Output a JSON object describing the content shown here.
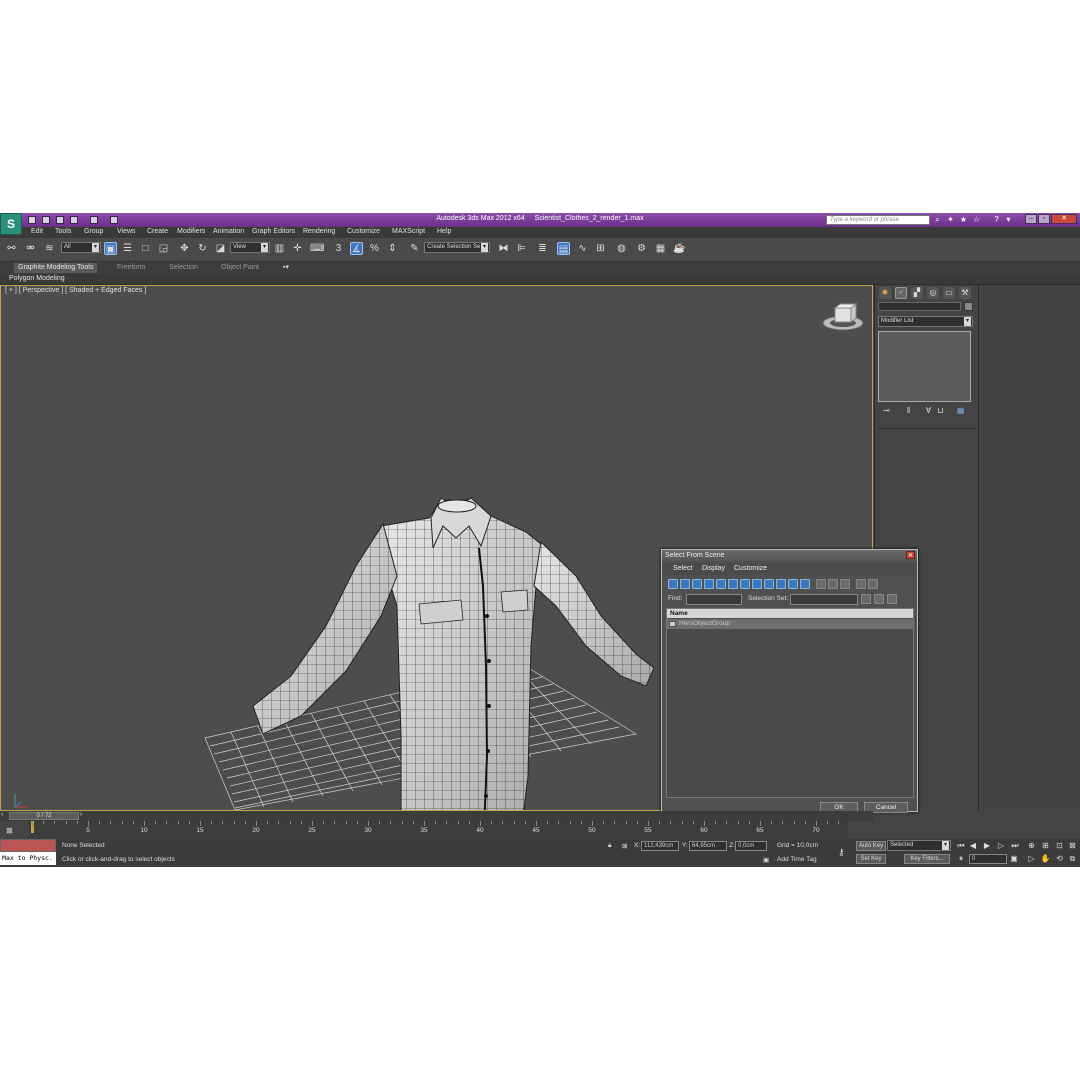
{
  "titlebar": {
    "app_name": "Autodesk 3ds Max  2012 x64",
    "file_name": "Scientist_Clothes_2_render_1.max",
    "search_placeholder": "Type a keyword or phrase",
    "app_logo": "3ds-max-logo"
  },
  "menu": [
    "Edit",
    "Tools",
    "Group",
    "Views",
    "Create",
    "Modifiers",
    "Animation",
    "Graph Editors",
    "Rendering",
    "Customize",
    "MAXScript",
    "Help"
  ],
  "toolbar": {
    "selection_filter": "All",
    "reference_coord": "View",
    "selection_set": "Create Selection Se",
    "snap_value": "3"
  },
  "ribbon": {
    "tabs": [
      "Graphite Modeling Tools",
      "Freeform",
      "Selection",
      "Object Paint"
    ],
    "active_tab": "Graphite Modeling Tools",
    "sub_label": "Polygon Modeling"
  },
  "viewport": {
    "label": "[ + ] [ Perspective ] [ Shaded + Edged Faces ]",
    "viewcube_face": "FRONT"
  },
  "command_panel": {
    "modifier_list": "Modifier List"
  },
  "dialog": {
    "title": "Select From Scene",
    "menu": [
      "Select",
      "Display",
      "Customize"
    ],
    "find_label": "Find:",
    "selection_set_label": "Selection Set:",
    "column_header": "Name",
    "rows": [
      "HeroObjectGroup"
    ],
    "ok_label": "OK",
    "cancel_label": "Cancel"
  },
  "timeline": {
    "frame_display": "0 / 72",
    "ticks": [
      "5",
      "10",
      "15",
      "20",
      "25",
      "30",
      "35",
      "40",
      "45",
      "50",
      "55",
      "60",
      "65",
      "70"
    ]
  },
  "status": {
    "maxscript_text": "Max to Physc.",
    "selection_status": "None Selected",
    "prompt": "Click or click-and-drag to select objects",
    "x_label": "X:",
    "x_value": "112,439cm",
    "y_label": "Y:",
    "y_value": "64,95cm",
    "z_label": "Z:",
    "z_value": "0,0cm",
    "grid": "Grid = 10,0cm",
    "add_time_tag": "Add Time Tag",
    "auto_key": "Auto Key",
    "set_key": "Set Key",
    "key_mode": "Selected",
    "key_filters": "Key Filters...",
    "current_frame": "0"
  }
}
